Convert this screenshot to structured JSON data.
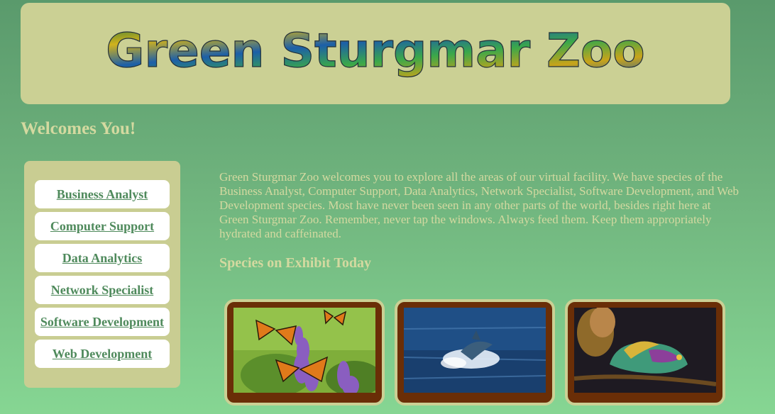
{
  "header": {
    "title": "Green Sturgmar Zoo"
  },
  "welcome": "Welcomes You!",
  "sidebar": {
    "items": [
      {
        "label": "Business Analyst"
      },
      {
        "label": "Computer Support"
      },
      {
        "label": "Data Analytics"
      },
      {
        "label": "Network Specialist"
      },
      {
        "label": "Software Development"
      },
      {
        "label": "Web Development"
      }
    ]
  },
  "main": {
    "intro": "Green Sturgmar Zoo welcomes you to explore all the areas of our virtual facility. We have species of the Business Analyst, Computer Support, Data Analytics, Network Specialist, Software Development, and Web Development species. Most have never been seen in any other parts of the world, besides right here at Green Sturgmar Zoo. Remember, never tap the windows. Always feed them. Keep them appropriately hydrated and caffeinated.",
    "species_heading": "Species on Exhibit Today",
    "exhibits": [
      {
        "icon": "butterfly-photo"
      },
      {
        "icon": "dolphin-photo"
      },
      {
        "icon": "chameleon-photo"
      }
    ]
  },
  "colors": {
    "banner": "#cbd094",
    "sidebar": "#c9cd92",
    "text": "#d4d9a0",
    "link": "#4f8a5c",
    "card_frame": "#6a2e07"
  }
}
